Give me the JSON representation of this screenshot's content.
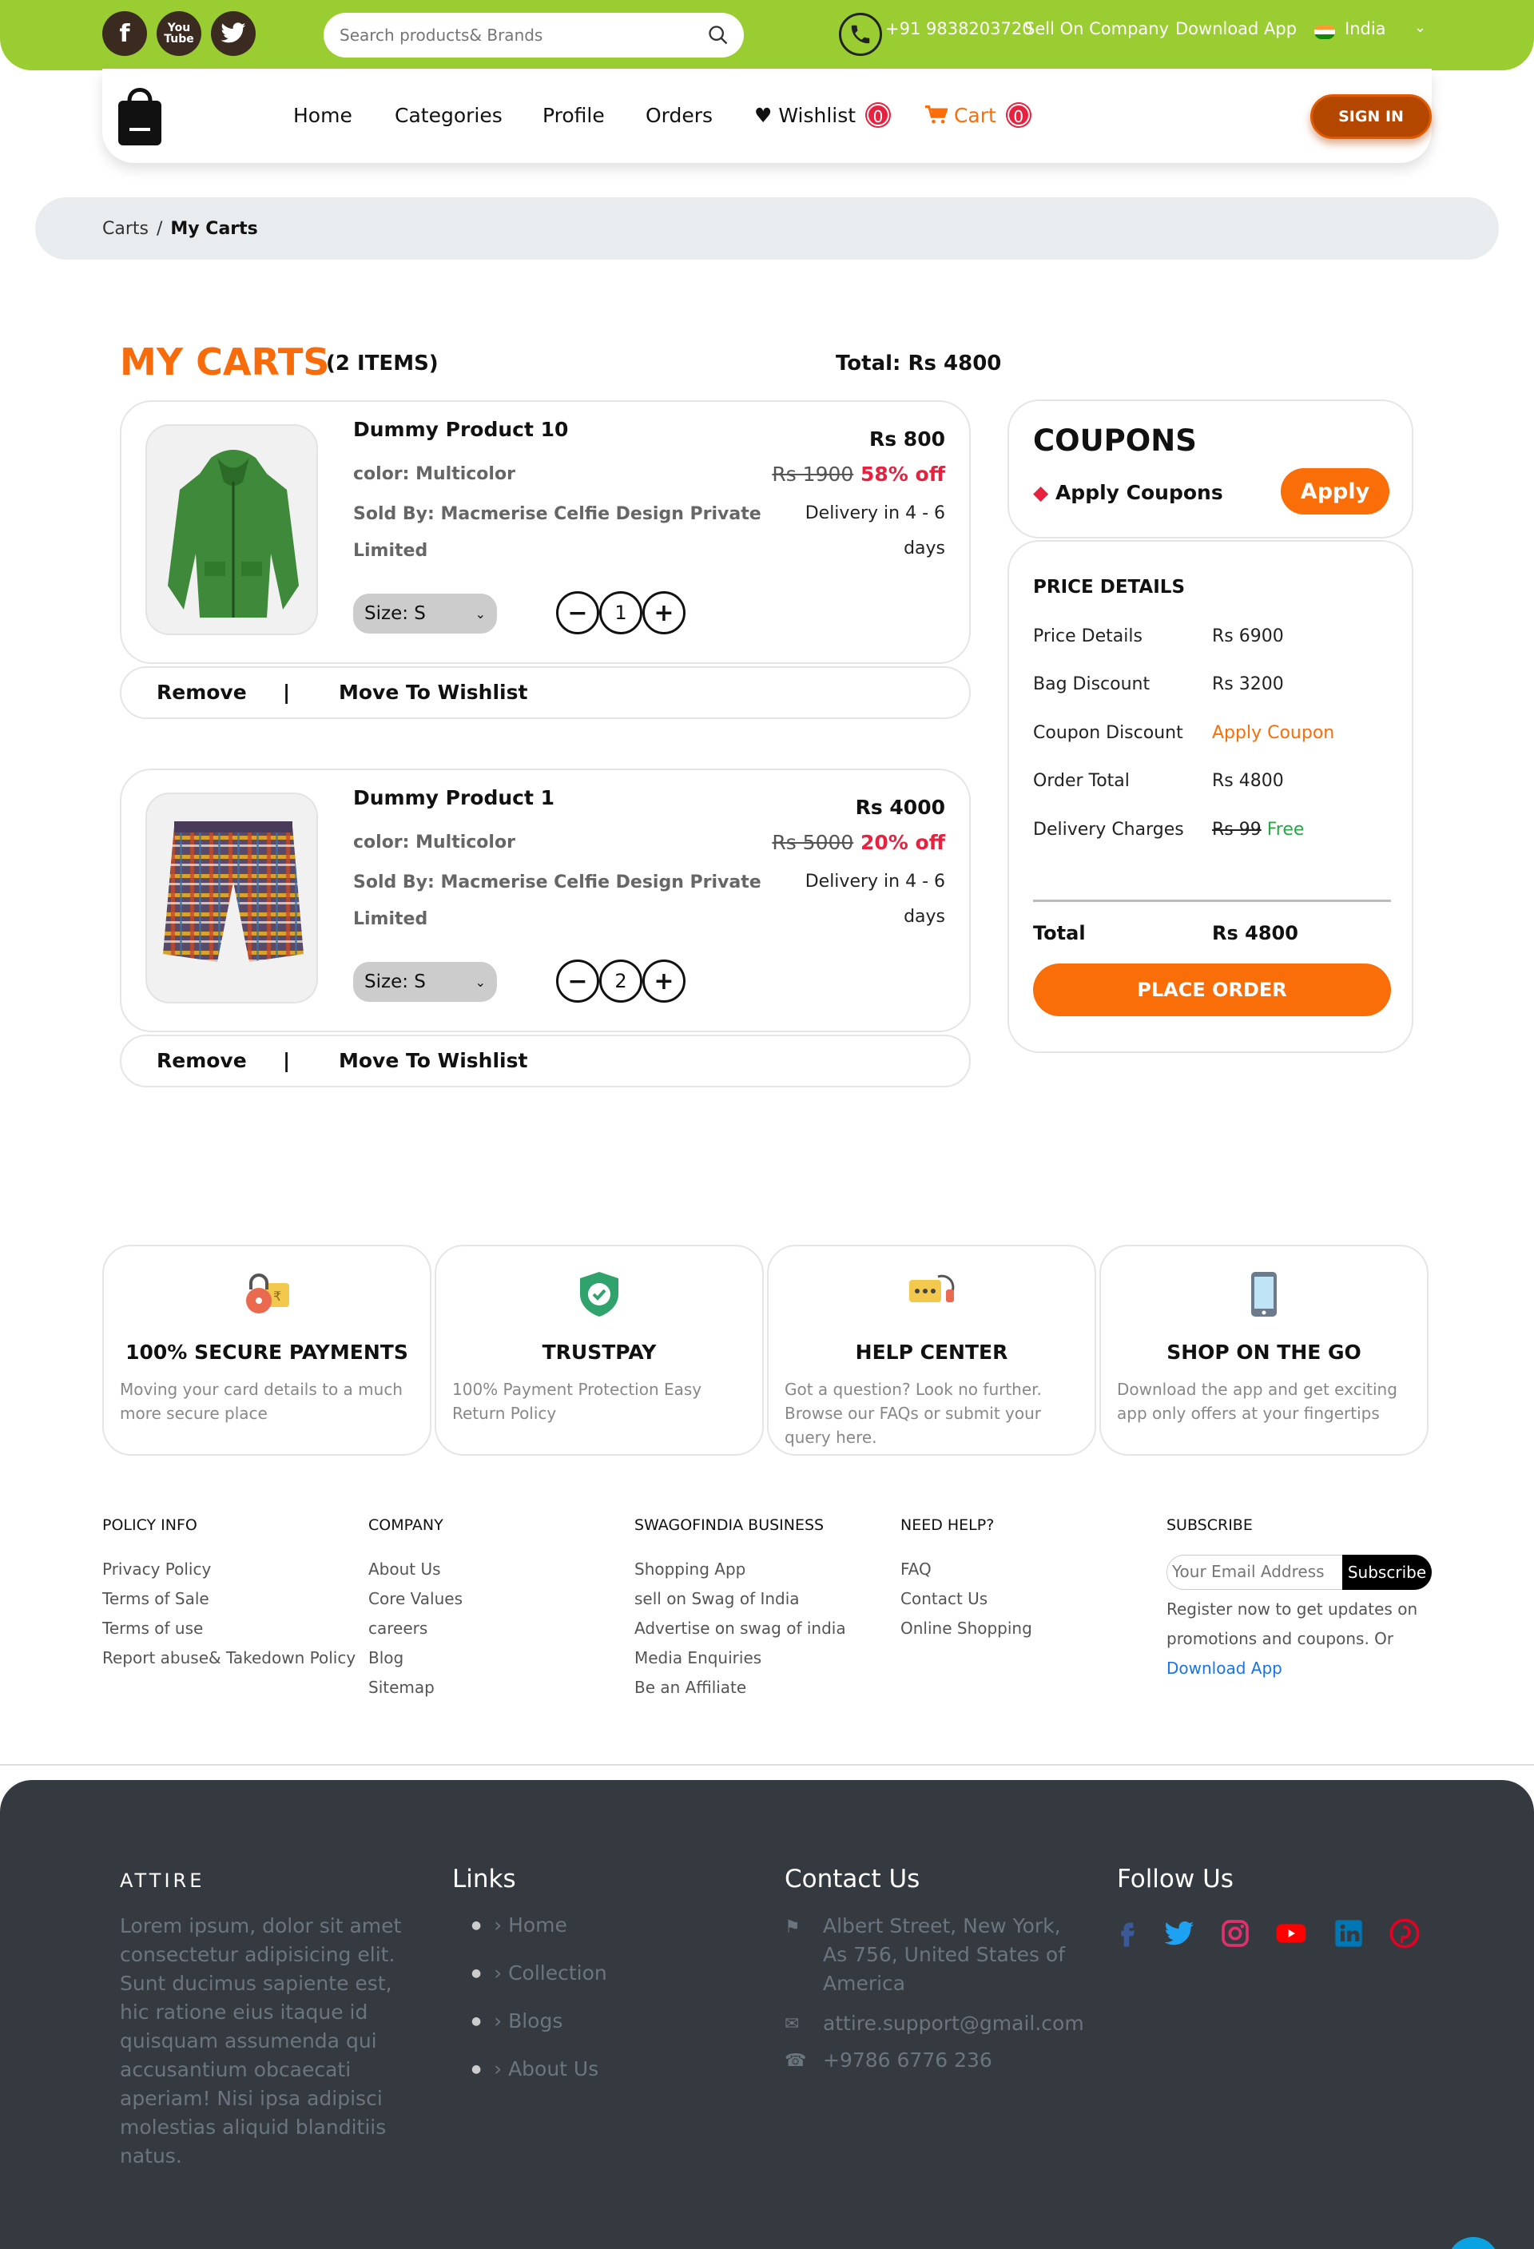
{
  "topbar": {
    "social": [
      "facebook-icon",
      "youtube-icon",
      "twitter-icon"
    ],
    "search_placeholder": "Search products& Brands",
    "phone": "+91 9838203720",
    "sell_link": "Sell On Company",
    "download_link": "Download App",
    "country": "India"
  },
  "nav": {
    "items": [
      "Home",
      "Categories",
      "Profile",
      "Orders"
    ],
    "wishlist_label": "Wishlist",
    "wishlist_count": "0",
    "cart_label": "Cart",
    "cart_count": "0",
    "signin": "SIGN IN"
  },
  "breadcrumb": {
    "parent": "Carts",
    "separator": "/",
    "current": "My Carts"
  },
  "cart": {
    "title": "MY CARTS",
    "count": "(2 ITEMS)",
    "total": "Total: Rs 4800",
    "items": [
      {
        "name": "Dummy Product 10",
        "color": "color: Multicolor",
        "sold_by": "Sold By: Macmerise Celfie Design Private",
        "sold_by_2": "Limited",
        "price": "Rs 800",
        "mrp": "Rs 1900",
        "discount": "58% off",
        "delivery": "Delivery in 4 - 6",
        "delivery_2": "days",
        "size": "Size: S",
        "qty": "1",
        "remove": "Remove",
        "sep": "|",
        "wishlist": "Move To Wishlist"
      },
      {
        "name": "Dummy Product 1",
        "color": "color: Multicolor",
        "sold_by": "Sold By: Macmerise Celfie Design Private",
        "sold_by_2": "Limited",
        "price": "Rs 4000",
        "mrp": "Rs 5000",
        "discount": "20% off",
        "delivery": "Delivery in 4 - 6",
        "delivery_2": "days",
        "size": "Size: S",
        "qty": "2",
        "remove": "Remove",
        "sep": "|",
        "wishlist": "Move To Wishlist"
      }
    ]
  },
  "coupons": {
    "title": "COUPONS",
    "label": "Apply Coupons",
    "button": "Apply"
  },
  "price_details": {
    "title": "PRICE DETAILS",
    "rows": [
      {
        "label": "Price Details",
        "value": "Rs 6900"
      },
      {
        "label": "Bag Discount",
        "value": "Rs 3200"
      },
      {
        "label": "Coupon Discount",
        "value": "Apply Coupon"
      },
      {
        "label": "Order Total",
        "value": "Rs 4800"
      },
      {
        "label": "Delivery Charges",
        "value": "Rs 99",
        "extra": "Free"
      }
    ],
    "total_label": "Total",
    "total_value": "Rs 4800",
    "place_order": "PLACE ORDER"
  },
  "features": [
    {
      "title": "100% SECURE PAYMENTS",
      "text": "Moving your card details to a much more secure place",
      "icon": "secure-payment-icon"
    },
    {
      "title": "TRUSTPAY",
      "text": "100% Payment Protection Easy Return Policy",
      "icon": "shield-check-icon"
    },
    {
      "title": "HELP CENTER",
      "text": "Got a question? Look no further. Browse our FAQs or submit your query here.",
      "icon": "help-chat-icon"
    },
    {
      "title": "SHOP ON THE GO",
      "text": "Download the app and get exciting app only offers at your fingertips",
      "icon": "mobile-phone-icon"
    }
  ],
  "footer_links": {
    "policy": {
      "title": "POLICY INFO",
      "links": [
        "Privacy Policy",
        "Terms of Sale",
        "Terms of use",
        "Report abuse& Takedown Policy"
      ]
    },
    "company": {
      "title": "COMPANY",
      "links": [
        "About Us",
        "Core Values",
        "careers",
        "Blog",
        "Sitemap"
      ]
    },
    "business": {
      "title": "SWAGOFINDIA BUSINESS",
      "links": [
        "Shopping App",
        "sell on Swag of India",
        "Advertise on swag of india",
        "Media Enquiries",
        "Be an Affiliate"
      ]
    },
    "help": {
      "title": "NEED HELP?",
      "links": [
        "FAQ",
        "Contact Us",
        "Online Shopping"
      ]
    },
    "subscribe": {
      "title": "SUBSCRIBE",
      "placeholder": "Your Email Address",
      "button": "Subscribe",
      "text": "Register now to get updates on promotions and coupons. Or",
      "download": "Download App"
    }
  },
  "dark_footer": {
    "attire_title": "ATTIRE",
    "attire_text": "Lorem ipsum, dolor sit amet consectetur adipisicing elit. Sunt ducimus sapiente est, hic ratione eius itaque id quisquam assumenda qui accusantium obcaecati aperiam! Nisi ipsa adipisci molestias aliquid blanditiis natus.",
    "links_title": "Links",
    "links": [
      "Home",
      "Collection",
      "Blogs",
      "About Us"
    ],
    "contact_title": "Contact Us",
    "address": "Albert Street, New York, As 756, United States of America",
    "email": "attire.support@gmail.com",
    "phone": "+9786 6776 236",
    "follow_title": "Follow Us",
    "social": [
      "facebook-icon",
      "twitter-icon",
      "instagram-icon",
      "youtube-icon",
      "linkedin-icon",
      "pinterest-icon"
    ]
  },
  "colors": {
    "brand_green": "#9acd32",
    "accent_orange": "#fa6e0a",
    "badge_red": "#e8213f",
    "footer_dark": "#343a40"
  }
}
